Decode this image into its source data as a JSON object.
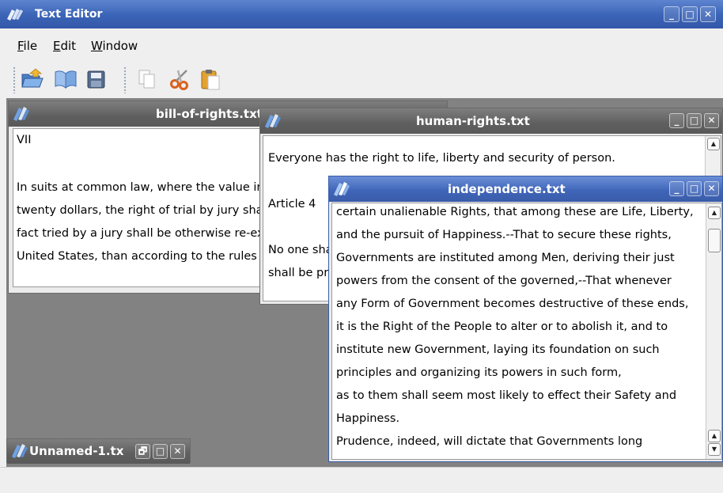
{
  "app": {
    "title": "Text Editor",
    "controls": {
      "minimize": "_",
      "maximize": "□",
      "close": "✕"
    }
  },
  "menu": {
    "items": [
      {
        "underlined": "F",
        "rest": "ile"
      },
      {
        "underlined": "E",
        "rest": "dit"
      },
      {
        "underlined": "W",
        "rest": "indow"
      }
    ]
  },
  "toolbar": {
    "buttons": [
      "open-folder-icon",
      "open-book-icon",
      "save-disk-icon",
      "copy-icon",
      "cut-scissors-icon",
      "paste-clipboard-icon"
    ]
  },
  "windows": {
    "bill": {
      "title": "bill-of-rights.txt",
      "lines": [
        "VII",
        "",
        "In suits at common law, where the value in controversy shall exceed",
        "twenty dollars, the right of trial by jury shall be preserved, and no",
        "fact tried by a jury shall be otherwise re-examined in any Court of the",
        "United States, than according to the rules of the common law."
      ]
    },
    "human": {
      "title": "human-rights.txt",
      "lines": [
        "",
        "Everyone has the right to life, liberty and security of person.",
        "",
        "Article 4",
        "",
        "No one shall be held in slavery or servitude;",
        "shall be prohibited in all their forms."
      ]
    },
    "independence": {
      "title": "independence.txt",
      "lines": [
        "certain unalienable Rights, that among these are Life, Liberty,",
        "and the pursuit of Happiness.--That to secure these rights,",
        "Governments are instituted among Men, deriving their just",
        "powers from the consent of the governed,--That whenever",
        "any Form of Government becomes destructive of these ends,",
        "it is the Right of the People to alter or to abolish it, and to",
        "institute new Government, laying its foundation on such",
        "principles and organizing its powers in such form,",
        "as to them shall seem most likely to effect their Safety and",
        "Happiness.",
        "Prudence, indeed, will dictate that Governments long"
      ]
    },
    "unnamed": {
      "title": "Unnamed-1.tx",
      "controls": {
        "restore": "🗗",
        "maximize": "□",
        "close": "✕"
      }
    }
  },
  "colors": {
    "active_title": "#4066b9",
    "inactive_title": "#666666",
    "mdi_background": "#828282"
  }
}
